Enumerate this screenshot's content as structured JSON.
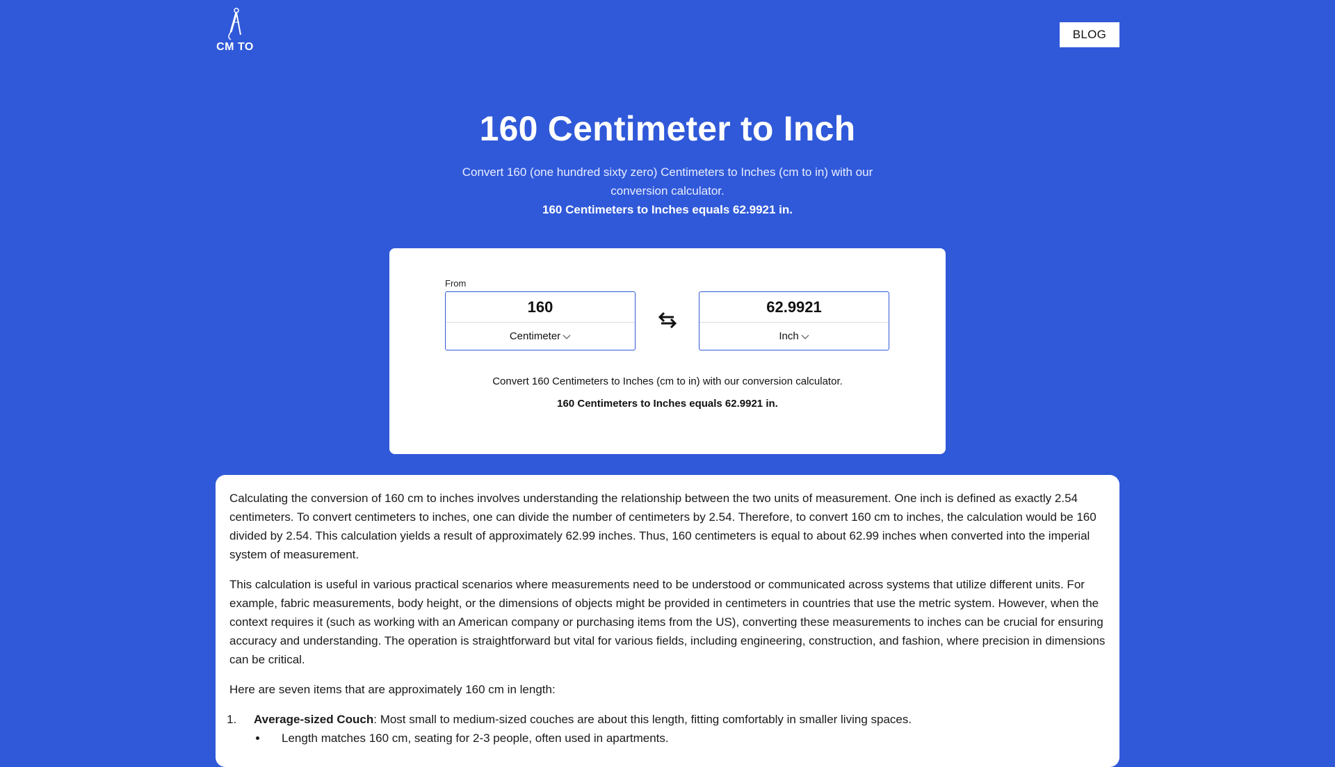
{
  "header": {
    "logo_text": "CM TO",
    "blog_label": "BLOG"
  },
  "hero": {
    "title": "160 Centimeter to Inch",
    "subtitle": "Convert 160 (one hundred sixty zero) Centimeters to Inches (cm to in) with our conversion calculator.",
    "result": "160 Centimeters to Inches equals 62.9921 in."
  },
  "converter": {
    "from_label": "From",
    "from_value": "160",
    "from_unit": "Centimeter",
    "to_value": "62.9921",
    "to_unit": "Inch",
    "swap_icon": "swap-arrows-icon",
    "description": "Convert 160 Centimeters to Inches (cm to in) with our conversion calculator.",
    "result": "160 Centimeters to Inches equals 62.9921 in."
  },
  "article": {
    "paragraph1": "Calculating the conversion of 160 cm to inches involves understanding the relationship between the two units of measurement. One inch is defined as exactly 2.54 centimeters. To convert centimeters to inches, one can divide the number of centimeters by 2.54. Therefore, to convert 160 cm to inches, the calculation would be 160 divided by 2.54. This calculation yields a result of approximately 62.99 inches. Thus, 160 centimeters is equal to about 62.99 inches when converted into the imperial system of measurement.",
    "paragraph2": "This calculation is useful in various practical scenarios where measurements need to be understood or communicated across systems that utilize different units. For example, fabric measurements, body height, or the dimensions of objects might be provided in centimeters in countries that use the metric system. However, when the context requires it (such as working with an American company or purchasing items from the US), converting these measurements to inches can be crucial for ensuring accuracy and understanding. The operation is straightforward but vital for various fields, including engineering, construction, and fashion, where precision in dimensions can be critical.",
    "intro": "Here are seven items that are approximately 160 cm in length:",
    "items": [
      {
        "title": "Average-sized Couch",
        "text": ": Most small to medium-sized couches are about this length, fitting comfortably in smaller living spaces.",
        "bullet": "Length matches 160 cm, seating for 2-3 people, often used in apartments."
      }
    ]
  },
  "colors": {
    "background": "#3059d9",
    "card": "#ffffff",
    "input_border": "#3059d9"
  }
}
